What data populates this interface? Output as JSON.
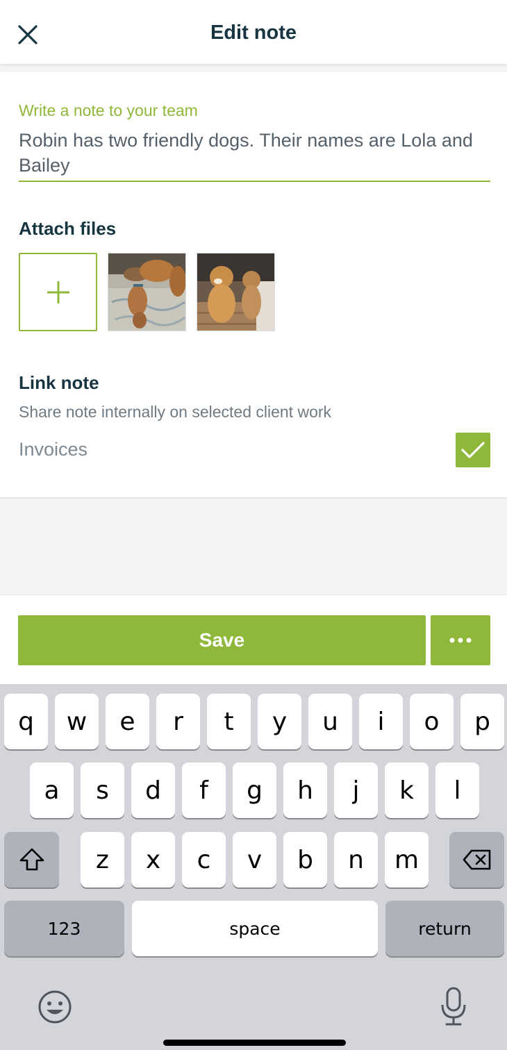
{
  "header": {
    "title": "Edit note"
  },
  "note": {
    "label": "Write a note to your team",
    "text": "Robin has two friendly dogs. Their names are Lola and Bailey"
  },
  "attach": {
    "title": "Attach files"
  },
  "link": {
    "title": "Link note",
    "subtitle": "Share note internally on selected client work",
    "option_label": "Invoices",
    "option_checked": true
  },
  "actions": {
    "save_label": "Save"
  },
  "keyboard": {
    "row1": [
      "q",
      "w",
      "e",
      "r",
      "t",
      "y",
      "u",
      "i",
      "o",
      "p"
    ],
    "row2": [
      "a",
      "s",
      "d",
      "f",
      "g",
      "h",
      "j",
      "k",
      "l"
    ],
    "row3": [
      "z",
      "x",
      "c",
      "v",
      "b",
      "n",
      "m"
    ],
    "numbers_label": "123",
    "space_label": "space",
    "return_label": "return"
  },
  "colors": {
    "accent": "#8fb83a",
    "title": "#163540",
    "keyboard_bg": "#d3d5db"
  }
}
